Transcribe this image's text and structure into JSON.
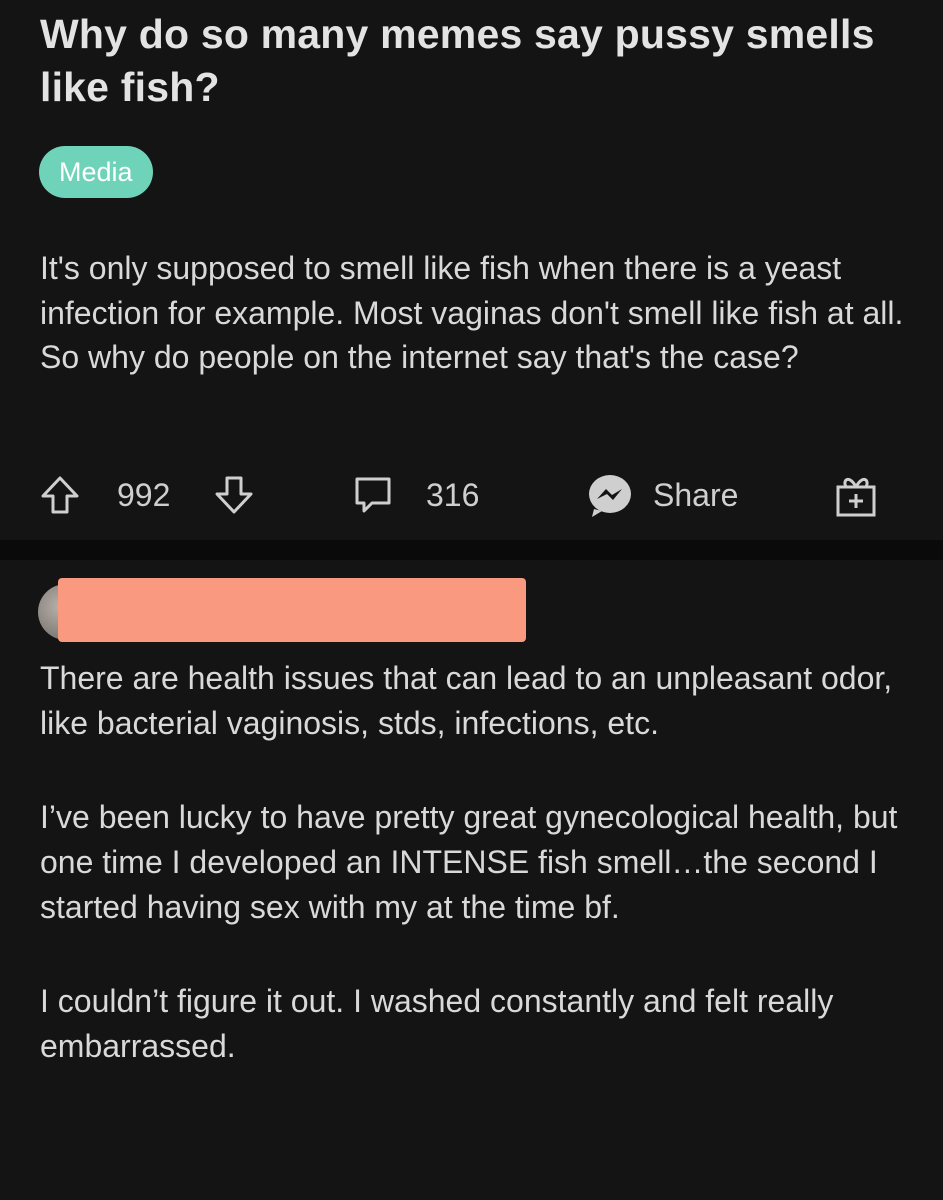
{
  "post": {
    "title": "Why do so many memes say pussy smells like fish?",
    "flair": "Media",
    "flair_color": "#6fd3b9",
    "body": "It's only supposed to smell like fish when there is a yeast infection for example. Most vaginas don't smell like fish at all. So why do people on the internet say that's the case?",
    "actions": {
      "score": "992",
      "comments": "316",
      "share_label": "Share",
      "icons": [
        "upvote-icon",
        "downvote-icon",
        "comment-icon",
        "messenger-icon",
        "award-icon"
      ]
    }
  },
  "comment": {
    "paragraphs": [
      "There are health issues that can lead to an unpleasant odor, like bacterial vaginosis, stds, infections, etc.",
      "I’ve been lucky to have pretty great gynecological health, but one time I developed an INTENSE fish smell…the second I started having sex with my at the time bf.",
      "I couldn’t figure it out. I washed constantly and felt really embarrassed."
    ],
    "redaction_color": "#f99a80"
  }
}
